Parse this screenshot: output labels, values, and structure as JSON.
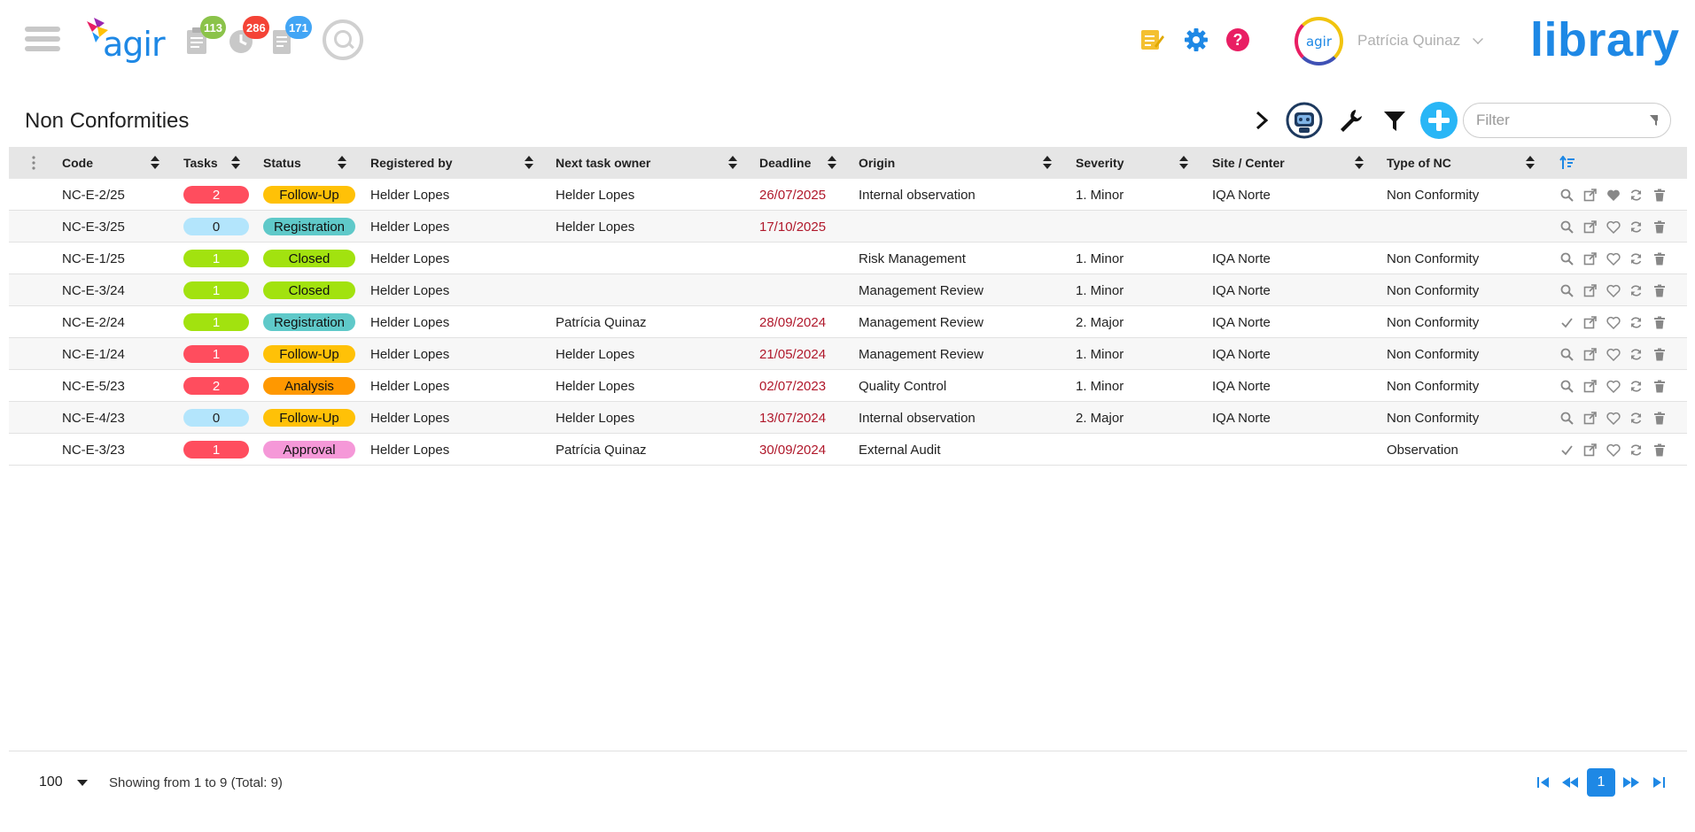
{
  "header": {
    "logo_text": "agir",
    "counters": [
      {
        "name": "tasks",
        "count": "113",
        "color": "#8bc34a"
      },
      {
        "name": "overdue",
        "count": "286",
        "color": "#f44336"
      },
      {
        "name": "documents",
        "count": "171",
        "color": "#42a5f5"
      }
    ],
    "user": {
      "avatar_text": "agir",
      "name": "Patrícia Quinaz"
    },
    "brand": "library"
  },
  "page": {
    "title": "Non Conformities",
    "filter_placeholder": "Filter"
  },
  "table": {
    "columns": [
      "Code",
      "Tasks",
      "Status",
      "Registered by",
      "Next task owner",
      "Deadline",
      "Origin",
      "Severity",
      "Site / Center",
      "Type of NC"
    ],
    "rows": [
      {
        "code": "NC-E-2/25",
        "tasks": "2",
        "tasks_color": "#ff4d5e",
        "status": "Follow-Up",
        "status_color": "#ffc107",
        "registered_by": "Helder Lopes",
        "next_owner": "Helder Lopes",
        "deadline": "26/07/2025",
        "origin": "Internal observation",
        "severity": "1. Minor",
        "site": "IQA Norte",
        "type": "Non Conformity",
        "first_action": "search",
        "favorite": true
      },
      {
        "code": "NC-E-3/25",
        "tasks": "0",
        "tasks_color": "#b3e5fc",
        "status": "Registration",
        "status_color": "#5fc9c9",
        "registered_by": "Helder Lopes",
        "next_owner": "Helder Lopes",
        "deadline": "17/10/2025",
        "origin": "",
        "severity": "",
        "site": "",
        "type": "",
        "first_action": "search",
        "favorite": false
      },
      {
        "code": "NC-E-1/25",
        "tasks": "1",
        "tasks_color": "#a2e20f",
        "status": "Closed",
        "status_color": "#a2e20f",
        "registered_by": "Helder Lopes",
        "next_owner": "",
        "deadline": "",
        "origin": "Risk Management",
        "severity": "1. Minor",
        "site": "IQA Norte",
        "type": "Non Conformity",
        "first_action": "search",
        "favorite": false
      },
      {
        "code": "NC-E-3/24",
        "tasks": "1",
        "tasks_color": "#a2e20f",
        "status": "Closed",
        "status_color": "#a2e20f",
        "registered_by": "Helder Lopes",
        "next_owner": "",
        "deadline": "",
        "origin": "Management Review",
        "severity": "1. Minor",
        "site": "IQA Norte",
        "type": "Non Conformity",
        "first_action": "search",
        "favorite": false
      },
      {
        "code": "NC-E-2/24",
        "tasks": "1",
        "tasks_color": "#a2e20f",
        "status": "Registration",
        "status_color": "#5fc9c9",
        "registered_by": "Helder Lopes",
        "next_owner": "Patrícia Quinaz",
        "deadline": "28/09/2024",
        "origin": "Management Review",
        "severity": "2. Major",
        "site": "IQA Norte",
        "type": "Non Conformity",
        "first_action": "check",
        "favorite": false
      },
      {
        "code": "NC-E-1/24",
        "tasks": "1",
        "tasks_color": "#ff4d5e",
        "status": "Follow-Up",
        "status_color": "#ffc107",
        "registered_by": "Helder Lopes",
        "next_owner": "Helder Lopes",
        "deadline": "21/05/2024",
        "origin": "Management Review",
        "severity": "1. Minor",
        "site": "IQA Norte",
        "type": "Non Conformity",
        "first_action": "search",
        "favorite": false
      },
      {
        "code": "NC-E-5/23",
        "tasks": "2",
        "tasks_color": "#ff4d5e",
        "status": "Analysis",
        "status_color": "#ff9800",
        "registered_by": "Helder Lopes",
        "next_owner": "Helder Lopes",
        "deadline": "02/07/2023",
        "origin": "Quality Control",
        "severity": "1. Minor",
        "site": "IQA Norte",
        "type": "Non Conformity",
        "first_action": "search",
        "favorite": false
      },
      {
        "code": "NC-E-4/23",
        "tasks": "0",
        "tasks_color": "#b3e5fc",
        "status": "Follow-Up",
        "status_color": "#ffc107",
        "registered_by": "Helder Lopes",
        "next_owner": "Helder Lopes",
        "deadline": "13/07/2024",
        "origin": "Internal observation",
        "severity": "2. Major",
        "site": "IQA Norte",
        "type": "Non Conformity",
        "first_action": "search",
        "favorite": false
      },
      {
        "code": "NC-E-3/23",
        "tasks": "1",
        "tasks_color": "#ff4d5e",
        "status": "Approval",
        "status_color": "#f598d8",
        "registered_by": "Helder Lopes",
        "next_owner": "Patrícia Quinaz",
        "deadline": "30/09/2024",
        "origin": "External Audit",
        "severity": "",
        "site": "",
        "type": "Observation",
        "first_action": "check",
        "favorite": false
      }
    ]
  },
  "footer": {
    "page_size": "100",
    "showing": "Showing from 1 to 9 (Total: 9)",
    "current_page": "1"
  }
}
